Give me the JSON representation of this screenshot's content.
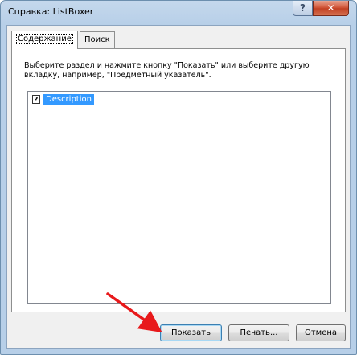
{
  "window": {
    "title": "Справка: ListBoxer",
    "help_button": "?",
    "close_button": "✕"
  },
  "tabs": [
    {
      "label": "Содержание",
      "active": true
    },
    {
      "label": "Поиск",
      "active": false
    }
  ],
  "contents": {
    "instructions": "Выберите раздел и нажмите кнопку \"Показать\" или выберите другую вкладку, например, \"Предметный указатель\".",
    "items": [
      {
        "icon": "help-topic-icon",
        "glyph": "?",
        "label": "Description",
        "selected": true
      }
    ]
  },
  "buttons": {
    "show": "Показать",
    "print": "Печать...",
    "cancel": "Отмена"
  },
  "colors": {
    "selection": "#3399ff",
    "annotation_arrow": "#e8191b",
    "close_button": "#c24023"
  }
}
